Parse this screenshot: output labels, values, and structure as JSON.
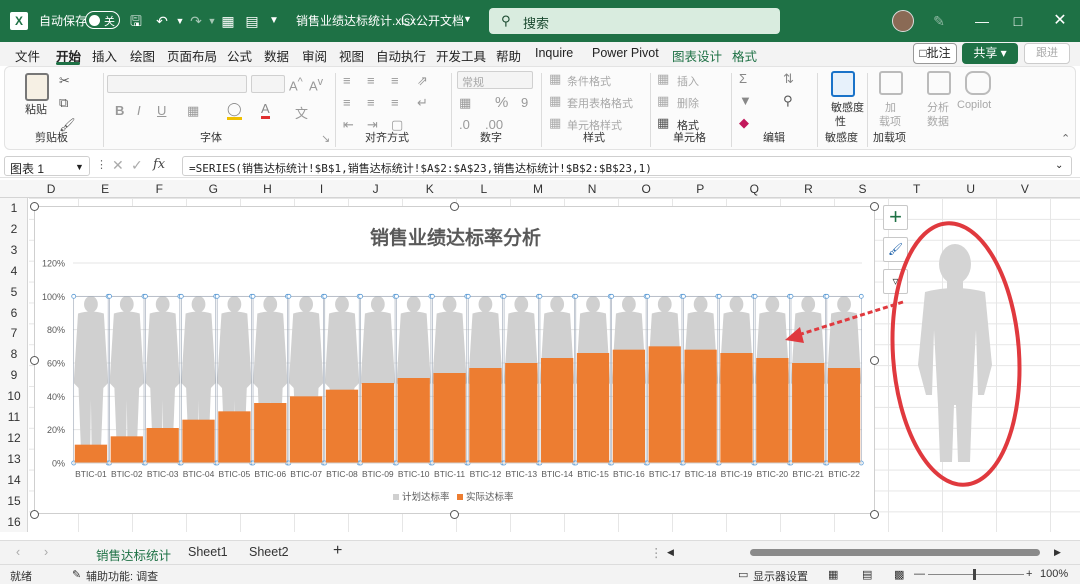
{
  "titlebar": {
    "autosave_label": "自动保存",
    "autosave_state": "关",
    "filename": "销售业绩达标统计.xlsx",
    "share_state": "公开文档",
    "search_label": "搜索"
  },
  "menu": {
    "items": [
      "文件",
      "开始",
      "插入",
      "绘图",
      "页面布局",
      "公式",
      "数据",
      "审阅",
      "视图",
      "自动执行",
      "开发工具",
      "帮助",
      "Inquire",
      "Power Pivot",
      "图表设计",
      "格式"
    ],
    "comment_label": "批注",
    "share_label": "共享",
    "share_suffix": "跟进"
  },
  "ribbon": {
    "paste_label": "粘贴",
    "groups": [
      "剪贴板",
      "字体",
      "对齐方式",
      "数字",
      "样式",
      "单元格",
      "编辑",
      "敏感度",
      "加载项"
    ],
    "number_format": "常规",
    "style_items": [
      "条件格式",
      "套用表格格式",
      "单元格样式"
    ],
    "cell_items": [
      "插入",
      "删除",
      "格式"
    ],
    "sensitivity_label": "敏感度",
    "sensitivity_line2": "性",
    "addin_line1": "加",
    "addin_line2": "载项",
    "analyze_line1": "分析",
    "analyze_line2": "数据",
    "copilot_label": "Copilot",
    "percent_symbol": "%",
    "fx_label": "fx"
  },
  "formula_bar": {
    "name_box": "图表 1",
    "formula": "=SERIES(销售达标统计!$B$1,销售达标统计!$A$2:$A$23,销售达标统计!$B$2:$B$23,1)"
  },
  "columns": [
    "D",
    "E",
    "F",
    "G",
    "H",
    "I",
    "J",
    "K",
    "L",
    "M",
    "N",
    "O",
    "P",
    "Q",
    "R",
    "S",
    "T",
    "U",
    "V"
  ],
  "rows": [
    "1",
    "2",
    "3",
    "4",
    "5",
    "6",
    "7",
    "8",
    "9",
    "10",
    "11",
    "12",
    "13",
    "14",
    "15",
    "16"
  ],
  "chart_data": {
    "type": "bar",
    "title": "销售业绩达标率分析",
    "categories": [
      "BTIC-01",
      "BTIC-02",
      "BTIC-03",
      "BTIC-04",
      "BTIC-05",
      "BTIC-06",
      "BTIC-07",
      "BTIC-08",
      "BTIC-09",
      "BTIC-10",
      "BTIC-11",
      "BTIC-12",
      "BTIC-13",
      "BTIC-14",
      "BTIC-15",
      "BTIC-16",
      "BTIC-17",
      "BTIC-18",
      "BTIC-19",
      "BTIC-20",
      "BTIC-21",
      "BTIC-22"
    ],
    "series": [
      {
        "name": "计划达标率",
        "values": [
          1,
          1,
          1,
          1,
          1,
          1,
          1,
          1,
          1,
          1,
          1,
          1,
          1,
          1,
          1,
          1,
          1,
          1,
          1,
          1,
          1,
          1
        ],
        "color": "#d0d0d0"
      },
      {
        "name": "实际达标率",
        "values": [
          0.11,
          0.16,
          0.21,
          0.26,
          0.31,
          0.36,
          0.4,
          0.44,
          0.48,
          0.51,
          0.54,
          0.57,
          0.6,
          0.63,
          0.66,
          0.68,
          0.7,
          0.68,
          0.66,
          0.63,
          0.6,
          0.57
        ],
        "color": "#ed7d31"
      }
    ],
    "y_ticks": [
      "0%",
      "20%",
      "40%",
      "60%",
      "80%",
      "100%",
      "120%"
    ],
    "ylim": [
      0,
      1.2
    ],
    "grid": true,
    "legend_position": "bottom"
  },
  "sheets": {
    "tabs": [
      "销售达标统计",
      "Sheet1",
      "Sheet2"
    ],
    "add": "+"
  },
  "status": {
    "ready": "就绪",
    "accessibility": "辅助功能: 调查",
    "display_settings": "显示器设置",
    "zoom": "100%"
  },
  "colors": {
    "excel_green": "#1e7145",
    "bar_orange": "#ed7d31",
    "silhouette": "#d0d0d0",
    "annotation_red": "#e0393e"
  }
}
